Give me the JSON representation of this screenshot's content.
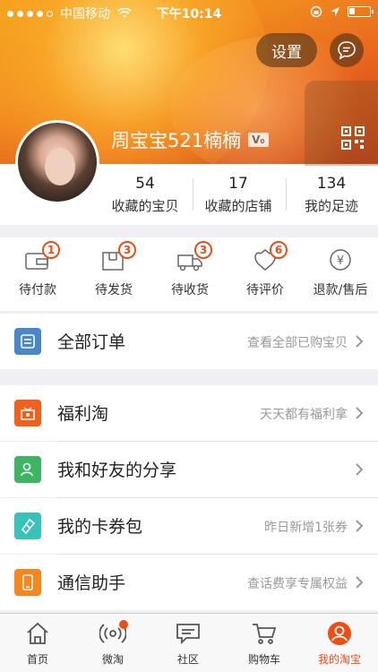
{
  "status_bar": {
    "carrier": "中国移动",
    "time": "下午10:14"
  },
  "header": {
    "settings_label": "设置",
    "username": "周宝宝521楠楠",
    "vip_badge": "V₀"
  },
  "stats": [
    {
      "count": "54",
      "label": "收藏的宝贝"
    },
    {
      "count": "17",
      "label": "收藏的店铺"
    },
    {
      "count": "134",
      "label": "我的足迹"
    }
  ],
  "orders": [
    {
      "label": "待付款",
      "badge": "1",
      "icon": "wallet-icon"
    },
    {
      "label": "待发货",
      "badge": "3",
      "icon": "package-icon"
    },
    {
      "label": "待收货",
      "badge": "3",
      "icon": "truck-icon"
    },
    {
      "label": "待评价",
      "badge": "6",
      "icon": "review-icon"
    },
    {
      "label": "退款/售后",
      "badge": "",
      "icon": "refund-icon"
    }
  ],
  "all_orders": {
    "title": "全部订单",
    "sub": "查看全部已购宝贝"
  },
  "menu": [
    {
      "title": "福利淘",
      "sub": "天天都有福利拿",
      "color": "#f25f1a",
      "icon": "gift-icon"
    },
    {
      "title": "我和好友的分享",
      "sub": "",
      "color": "#3eb562",
      "icon": "friends-icon"
    },
    {
      "title": "我的卡券包",
      "sub": "昨日新增1张券",
      "color": "#38c2b9",
      "icon": "ticket-icon"
    },
    {
      "title": "通信助手",
      "sub": "查话费享专属权益",
      "color": "#f7861d",
      "icon": "phone-icon"
    }
  ],
  "tabbar": [
    {
      "label": "首页",
      "icon": "home-icon"
    },
    {
      "label": "微淘",
      "icon": "broadcast-icon"
    },
    {
      "label": "社区",
      "icon": "chat-icon"
    },
    {
      "label": "购物车",
      "icon": "cart-icon"
    },
    {
      "label": "我的淘宝",
      "icon": "profile-icon"
    }
  ],
  "colors": {
    "accent": "#f04d13",
    "all_orders_icon": "#4a86c8"
  }
}
